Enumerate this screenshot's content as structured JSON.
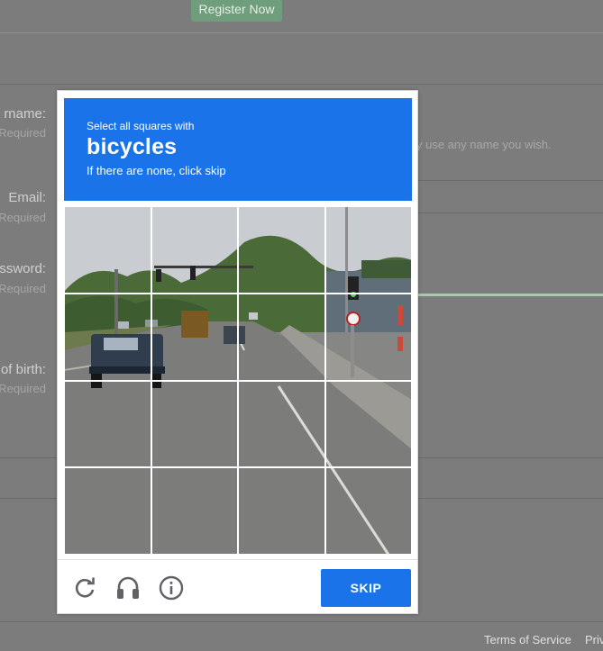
{
  "background": {
    "register_button": "Register Now",
    "fields": [
      {
        "label": "rname:",
        "required": "Required"
      },
      {
        "label": "Email:",
        "required": "Required"
      },
      {
        "label": "ssword:",
        "required": "Required"
      },
      {
        "label": "of birth:",
        "required": "Required"
      }
    ],
    "username_hint": "y use any name you wish.",
    "footer": {
      "terms": "Terms of Service",
      "privacy": "Priv"
    }
  },
  "captcha": {
    "instruction_small": "Select all squares with",
    "target": "bicycles",
    "instruction_note": "If there are none, click skip",
    "skip_label": "SKIP",
    "icons": [
      "reload-icon",
      "audio-icon",
      "info-icon"
    ],
    "accent_color": "#1a73e8"
  }
}
